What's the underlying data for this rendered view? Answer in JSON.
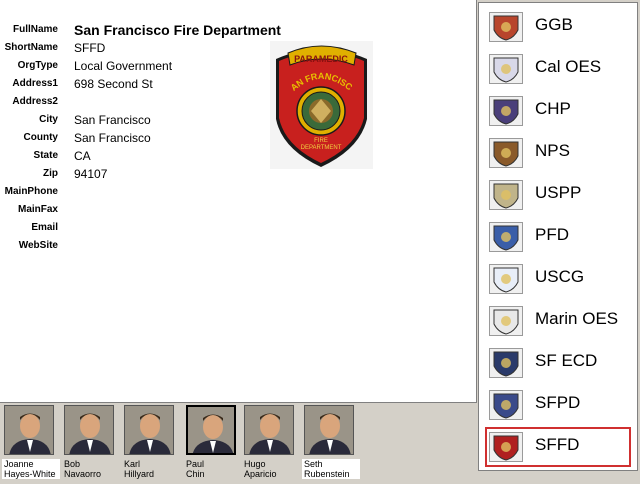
{
  "details": {
    "fields": [
      {
        "label": "FullName",
        "value": "San Francisco Fire Department"
      },
      {
        "label": "ShortName",
        "value": "SFFD"
      },
      {
        "label": "OrgType",
        "value": "Local Government"
      },
      {
        "label": "Address1",
        "value": "698 Second St"
      },
      {
        "label": "Address2",
        "value": ""
      },
      {
        "label": "City",
        "value": "San Francisco"
      },
      {
        "label": "County",
        "value": "San Francisco"
      },
      {
        "label": "State",
        "value": "CA"
      },
      {
        "label": "Zip",
        "value": "94107"
      },
      {
        "label": "MainPhone",
        "value": ""
      },
      {
        "label": "MainFax",
        "value": ""
      },
      {
        "label": "Email",
        "value": ""
      },
      {
        "label": "WebSite",
        "value": ""
      }
    ],
    "logo": {
      "top_text": "PARAMEDIC",
      "arc_text": "SAN FRANCISCO",
      "bottom_text": "FIRE",
      "bottom_text2": "DEPARTMENT"
    }
  },
  "organizations": [
    {
      "label": "GGB",
      "color": "#b8452c"
    },
    {
      "label": "Cal OES",
      "color": "#d8d8e8"
    },
    {
      "label": "CHP",
      "color": "#4a3f7a"
    },
    {
      "label": "NPS",
      "color": "#8a5a2a"
    },
    {
      "label": "USPP",
      "color": "#c0b48a"
    },
    {
      "label": "PFD",
      "color": "#3a5ea8"
    },
    {
      "label": "USCG",
      "color": "#e8eef8"
    },
    {
      "label": "Marin OES",
      "color": "#e8e8e8"
    },
    {
      "label": "SF ECD",
      "color": "#2a3a6a"
    },
    {
      "label": "SFPD",
      "color": "#3a4a8a"
    },
    {
      "label": "SFFD",
      "color": "#b02020",
      "selected": true
    }
  ],
  "people": [
    {
      "first": "Joanne",
      "last": "Hayes-White"
    },
    {
      "first": "Bob",
      "last": "Navaorro"
    },
    {
      "first": "Karl",
      "last": "Hillyard"
    },
    {
      "first": "Paul",
      "last": "Chin",
      "selected": true
    },
    {
      "first": "Hugo",
      "last": "Aparicio"
    },
    {
      "first": "Seth",
      "last": "Rubenstein"
    }
  ]
}
